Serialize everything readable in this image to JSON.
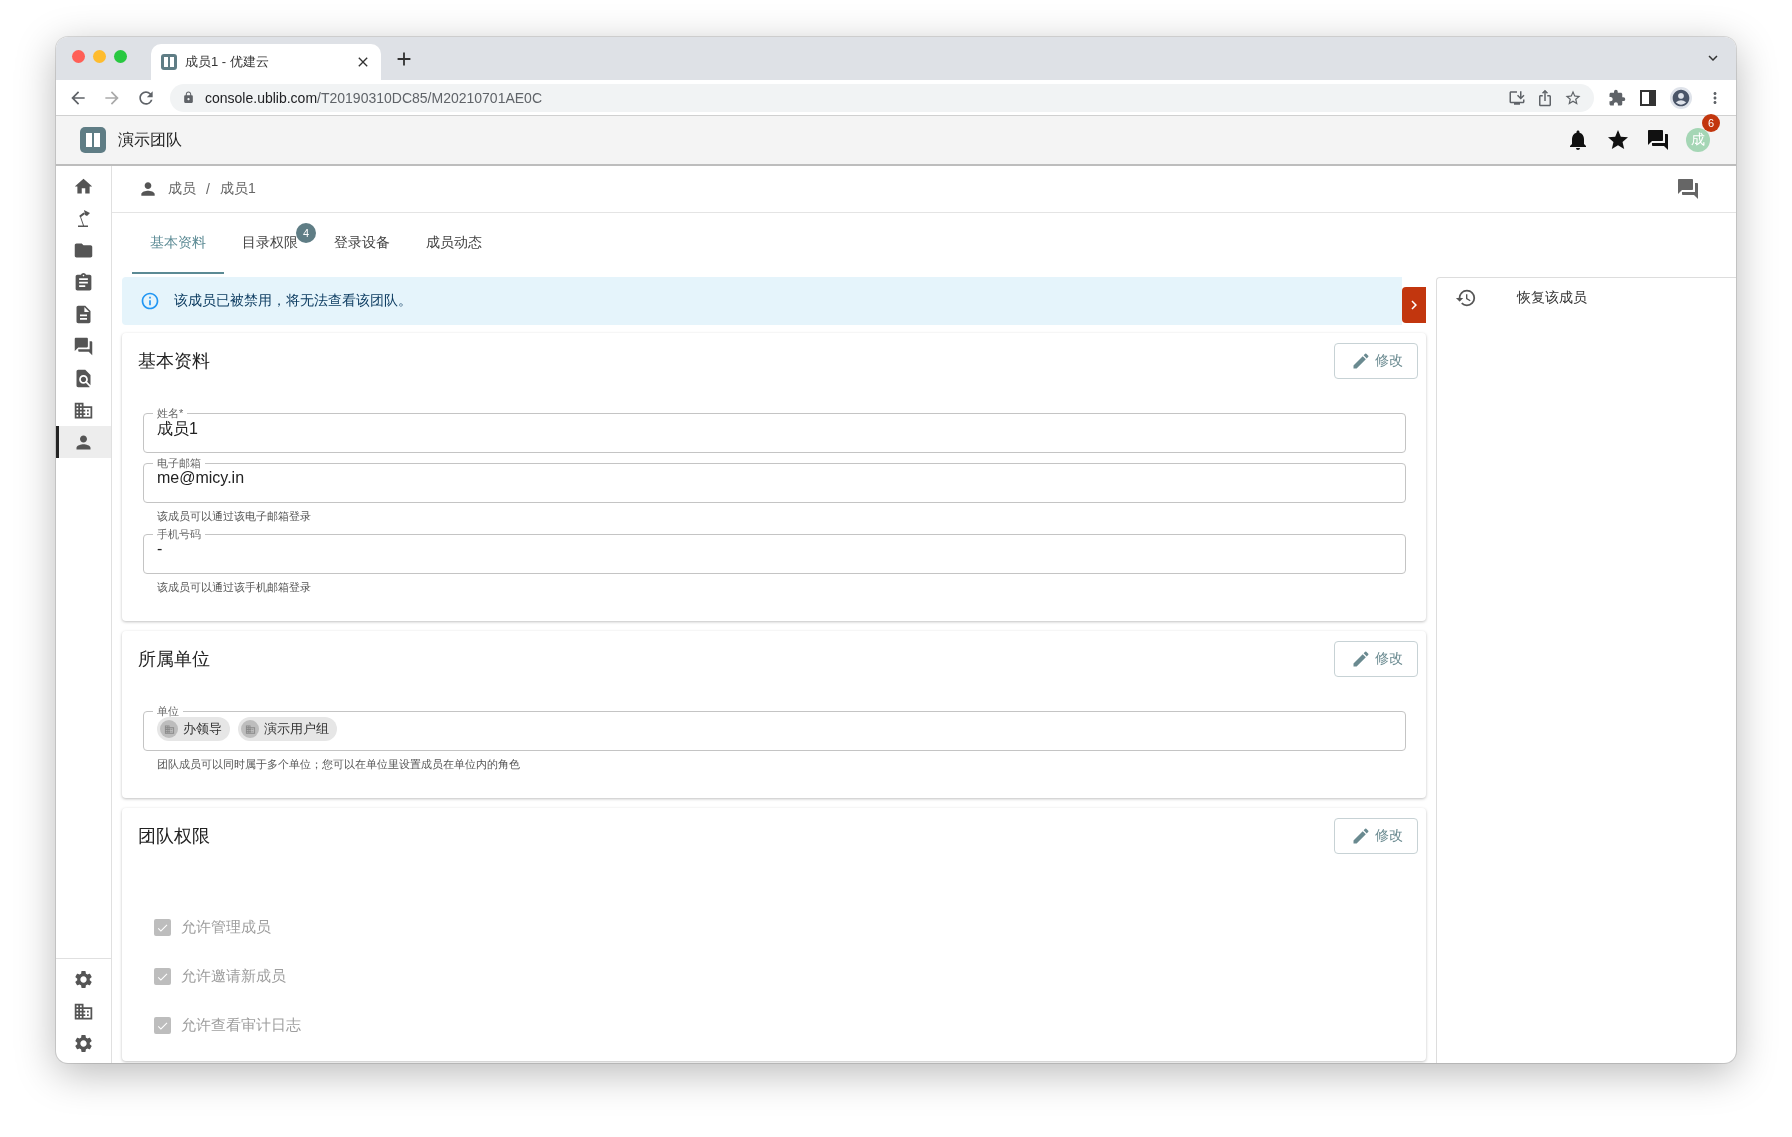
{
  "browser": {
    "tab_title": "成员1 - 优建云",
    "url_host": "console.ublib.com",
    "url_path": "/T20190310DC85/M20210701AE0C"
  },
  "app_header": {
    "title": "演示团队",
    "avatar_text": "成",
    "notification_count": "6"
  },
  "sidebar": {
    "items": [
      {
        "selected": false
      },
      {
        "selected": false
      },
      {
        "selected": false
      },
      {
        "selected": false
      },
      {
        "selected": false
      },
      {
        "selected": false
      },
      {
        "selected": false
      },
      {
        "selected": false
      },
      {
        "selected": true
      }
    ],
    "bottom_items": [
      {
        "selected": false
      },
      {
        "selected": false
      },
      {
        "selected": false
      }
    ]
  },
  "breadcrumb": {
    "items": [
      "成员",
      "成员1"
    ],
    "separator": "/"
  },
  "tabs": [
    {
      "label": "基本资料",
      "selected": true
    },
    {
      "label": "目录权限",
      "selected": false,
      "badge": "4"
    },
    {
      "label": "登录设备",
      "selected": false
    },
    {
      "label": "成员动态",
      "selected": false
    }
  ],
  "alert": {
    "text": "该成员已被禁用，将无法查看该团队。"
  },
  "basic_profile": {
    "title": "基本资料",
    "edit_button": "修改",
    "fields": [
      {
        "label": "姓名*",
        "value": "成员1"
      },
      {
        "label": "电子邮箱",
        "value": "me@micy.in",
        "helper": "该成员可以通过该电子邮箱登录"
      },
      {
        "label": "手机号码",
        "value": "-",
        "helper": "该成员可以通过该手机邮箱登录"
      }
    ]
  },
  "units": {
    "title": "所属单位",
    "edit_button": "修改",
    "field_label": "单位",
    "chips": [
      "办领导",
      "演示用户组"
    ],
    "helper": "团队成员可以同时属于多个单位；您可以在单位里设置成员在单位内的角色"
  },
  "permissions": {
    "title": "团队权限",
    "edit_button": "修改",
    "checkboxes": [
      {
        "label": "允许管理成员",
        "checked": true,
        "disabled": true
      },
      {
        "label": "允许邀请新成员",
        "checked": true,
        "disabled": true
      },
      {
        "label": "允许查看审计日志",
        "checked": true,
        "disabled": true
      }
    ]
  },
  "right_panel": {
    "actions": [
      {
        "label": "恢复该成员"
      }
    ]
  }
}
